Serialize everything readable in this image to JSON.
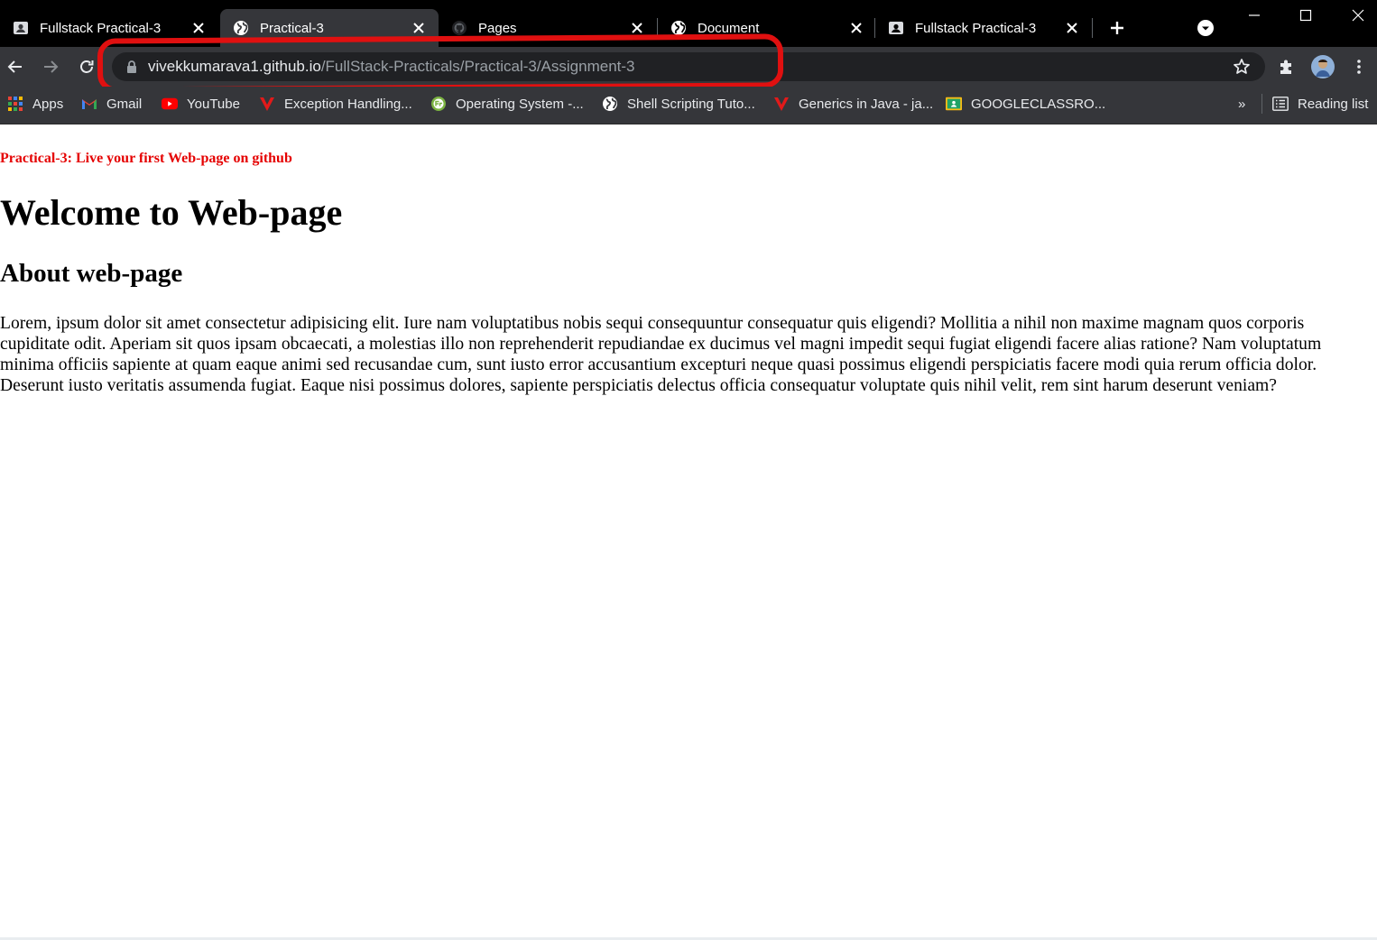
{
  "tabs": [
    {
      "title": "Fullstack Practical-3",
      "icon": "classroom-icon",
      "active": false
    },
    {
      "title": "Practical-3",
      "icon": "globe-icon",
      "active": true
    },
    {
      "title": "Pages",
      "icon": "github-icon",
      "active": false
    },
    {
      "title": "Document",
      "icon": "globe-icon",
      "active": false
    },
    {
      "title": "Fullstack Practical-3",
      "icon": "classroom-icon",
      "active": false
    }
  ],
  "address_bar": {
    "host": "vivekkumarava1.github.io",
    "path": "/FullStack-Practicals/Practical-3/Assignment-3"
  },
  "bookmarks": [
    {
      "label": "Apps",
      "icon": "apps-grid-icon"
    },
    {
      "label": "Gmail",
      "icon": "gmail-icon"
    },
    {
      "label": "YouTube",
      "icon": "youtube-icon"
    },
    {
      "label": "Exception Handling...",
      "icon": "javatpoint-icon"
    },
    {
      "label": "Operating System -...",
      "icon": "guru99-icon"
    },
    {
      "label": "Shell Scripting Tuto...",
      "icon": "globe-icon"
    },
    {
      "label": "Generics in Java - ja...",
      "icon": "javatpoint-icon"
    },
    {
      "label": "GOOGLECLASSRO...",
      "icon": "classroom-icon"
    }
  ],
  "more_bookmarks": "»",
  "reading_list": "Reading list",
  "page": {
    "practical_title": "Practical-3: Live your first Web-page on github",
    "h1": "Welcome to Web-page",
    "h2": "About web-page",
    "paragraph": "Lorem, ipsum dolor sit amet consectetur adipisicing elit. Iure nam voluptatibus nobis sequi consequuntur consequatur quis eligendi? Mollitia a nihil non maxime magnam quos corporis cupiditate odit. Aperiam sit quos ipsam obcaecati, a molestias illo non reprehenderit repudiandae ex ducimus vel magni impedit sequi fugiat eligendi facere alias ratione? Nam voluptatum minima officiis sapiente at quam eaque animi sed recusandae cum, sunt iusto error accusantium excepturi neque quasi possimus eligendi perspiciatis facere modi quia rerum officia dolor. Deserunt iusto veritatis assumenda fugiat. Eaque nisi possimus dolores, sapiente perspiciatis delectus officia consequatur voluptate quis nihil velit, rem sint harum deserunt veniam?"
  },
  "colors": {
    "annotation": "#e01010",
    "practical_title": "#e50000"
  }
}
